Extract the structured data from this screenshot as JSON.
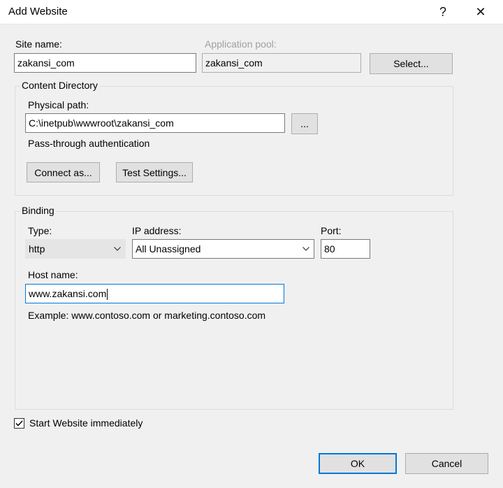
{
  "window": {
    "title": "Add Website",
    "help_glyph": "?",
    "close_glyph": "✕"
  },
  "site": {
    "name_label": "Site name:",
    "name_value": "zakansi_com",
    "app_pool_label": "Application pool:",
    "app_pool_value": "zakansi_com",
    "select_button": "Select..."
  },
  "content_directory": {
    "legend": "Content Directory",
    "physical_path_label": "Physical path:",
    "physical_path_value": "C:\\inetpub\\wwwroot\\zakansi_com",
    "browse_button": "...",
    "passthrough_text": "Pass-through authentication",
    "connect_as_button": "Connect as...",
    "test_settings_button": "Test Settings..."
  },
  "binding": {
    "legend": "Binding",
    "type_label": "Type:",
    "type_value": "http",
    "ip_label": "IP address:",
    "ip_value": "All Unassigned",
    "port_label": "Port:",
    "port_value": "80",
    "host_label": "Host name:",
    "host_value": "www.zakansi.com",
    "example_text": "Example: www.contoso.com or marketing.contoso.com"
  },
  "start_immediately": {
    "label": "Start Website immediately",
    "checked": true
  },
  "footer": {
    "ok_button": "OK",
    "cancel_button": "Cancel"
  },
  "colors": {
    "accent": "#0078d7",
    "dialog_bg": "#f0f0f0",
    "button_bg": "#e1e1e1"
  }
}
